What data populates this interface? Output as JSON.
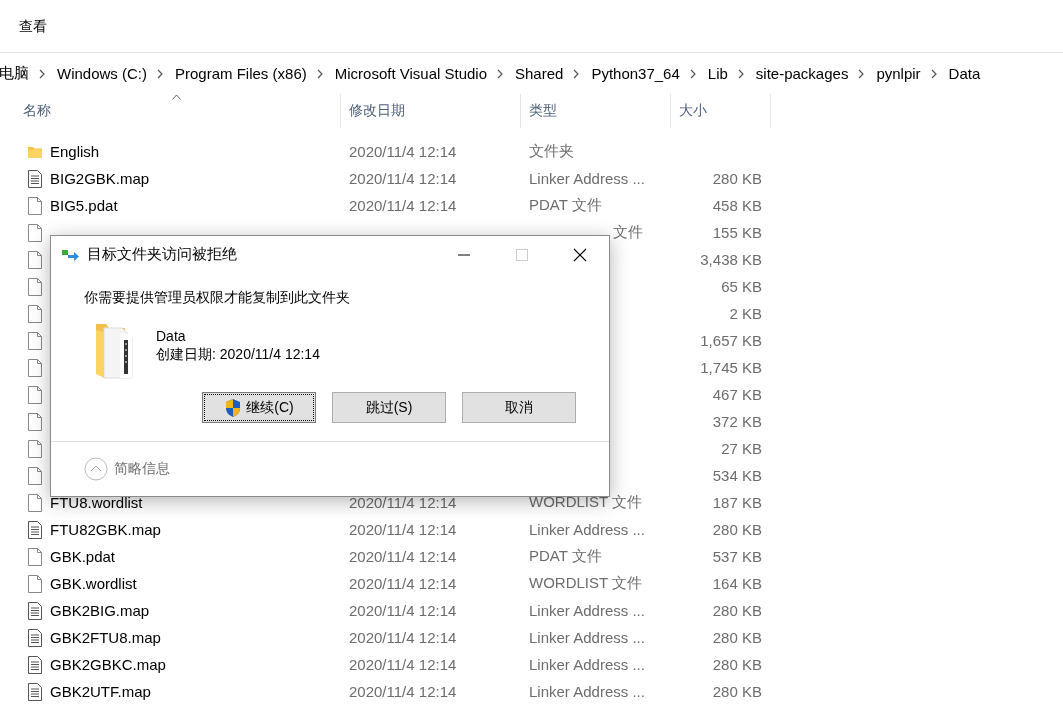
{
  "menu": [
    {
      "label": "查看"
    }
  ],
  "breadcrumb": [
    "电脑",
    "Windows (C:)",
    "Program Files (x86)",
    "Microsoft Visual Studio",
    "Shared",
    "Python37_64",
    "Lib",
    "site-packages",
    "pynlpir",
    "Data"
  ],
  "columns": [
    {
      "label": "名称",
      "sorted": true
    },
    {
      "label": "修改日期"
    },
    {
      "label": "类型"
    },
    {
      "label": "大小"
    }
  ],
  "rows": [
    {
      "kind": "folder",
      "name": "English",
      "modified": "2020/11/4 12:14",
      "type": "文件夹"
    },
    {
      "kind": "map",
      "name": "BIG2GBK.map",
      "modified": "2020/11/4 12:14",
      "type": "Linker Address ...",
      "size": "280 KB"
    },
    {
      "kind": "blank",
      "name": "BIG5.pdat",
      "modified": "2020/11/4 12:14",
      "type": "PDAT 文件",
      "size": "458 KB"
    },
    {
      "kind": "blank",
      "clipped": true,
      "type": "文件",
      "size": "155 KB"
    },
    {
      "kind": "blank",
      "size": "3,438 KB"
    },
    {
      "kind": "blank",
      "size": "65 KB"
    },
    {
      "kind": "blank",
      "size": "2 KB"
    },
    {
      "kind": "blank",
      "size": "1,657 KB"
    },
    {
      "kind": "blank",
      "size": "1,745 KB"
    },
    {
      "kind": "blank",
      "size": "467 KB"
    },
    {
      "kind": "blank",
      "size": "372 KB"
    },
    {
      "kind": "blank",
      "size": "27 KB"
    },
    {
      "kind": "blank",
      "size": "534 KB"
    },
    {
      "kind": "blank",
      "name": "FTU8.wordlist",
      "modified": "2020/11/4 12:14",
      "type": "WORDLIST 文件",
      "size": "187 KB"
    },
    {
      "kind": "map",
      "name": "FTU82GBK.map",
      "modified": "2020/11/4 12:14",
      "type": "Linker Address ...",
      "size": "280 KB"
    },
    {
      "kind": "blank",
      "name": "GBK.pdat",
      "modified": "2020/11/4 12:14",
      "type": "PDAT 文件",
      "size": "537 KB"
    },
    {
      "kind": "blank",
      "name": "GBK.wordlist",
      "modified": "2020/11/4 12:14",
      "type": "WORDLIST 文件",
      "size": "164 KB"
    },
    {
      "kind": "map",
      "name": "GBK2BIG.map",
      "modified": "2020/11/4 12:14",
      "type": "Linker Address ...",
      "size": "280 KB"
    },
    {
      "kind": "map",
      "name": "GBK2FTU8.map",
      "modified": "2020/11/4 12:14",
      "type": "Linker Address ...",
      "size": "280 KB"
    },
    {
      "kind": "map",
      "name": "GBK2GBKC.map",
      "modified": "2020/11/4 12:14",
      "type": "Linker Address ...",
      "size": "280 KB"
    },
    {
      "kind": "map",
      "name": "GBK2UTF.map",
      "modified": "2020/11/4 12:14",
      "type": "Linker Address ...",
      "size": "280 KB"
    }
  ],
  "dialog": {
    "title": "目标文件夹访问被拒绝",
    "maximize_disabled": true,
    "message": "你需要提供管理员权限才能复制到此文件夹",
    "item": {
      "name": "Data",
      "created": "创建日期: 2020/11/4 12:14"
    },
    "buttons": [
      {
        "label": "继续(C)",
        "kind": "elevated",
        "focused": true
      },
      {
        "label": "跳过(S)",
        "kind": "plain",
        "focused": false
      },
      {
        "label": "取消",
        "kind": "plain",
        "focused": false
      }
    ],
    "details_toggle": "简略信息"
  }
}
